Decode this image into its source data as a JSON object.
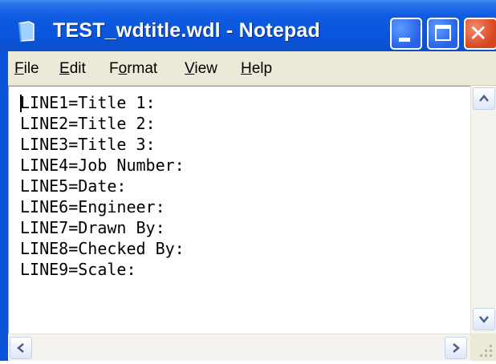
{
  "window": {
    "title": "TEST_wdtitle.wdl - Notepad",
    "app_icon": "notepad-icon",
    "controls": [
      "minimize",
      "maximize",
      "close"
    ]
  },
  "menu": {
    "items": [
      {
        "label": "File",
        "mnemonic": "F",
        "rest": "ile"
      },
      {
        "label": "Edit",
        "mnemonic": "E",
        "rest": "dit"
      },
      {
        "label": "Format",
        "before": "F",
        "mnemonic": "o",
        "rest": "rmat"
      },
      {
        "label": "View",
        "mnemonic": "V",
        "rest": "iew"
      },
      {
        "label": "Help",
        "mnemonic": "H",
        "rest": "elp"
      }
    ]
  },
  "document": {
    "lines": [
      "LINE1=Title 1:",
      "LINE2=Title 2:",
      "LINE3=Title 3:",
      "LINE4=Job Number:",
      "LINE5=Date:",
      "LINE6=Engineer:",
      "LINE7=Drawn By:",
      "LINE8=Checked By:",
      "LINE9=Scale:"
    ]
  },
  "colors": {
    "titlebar": "#0a55db",
    "close_button": "#d8441f",
    "menubar": "#ece9d8"
  }
}
